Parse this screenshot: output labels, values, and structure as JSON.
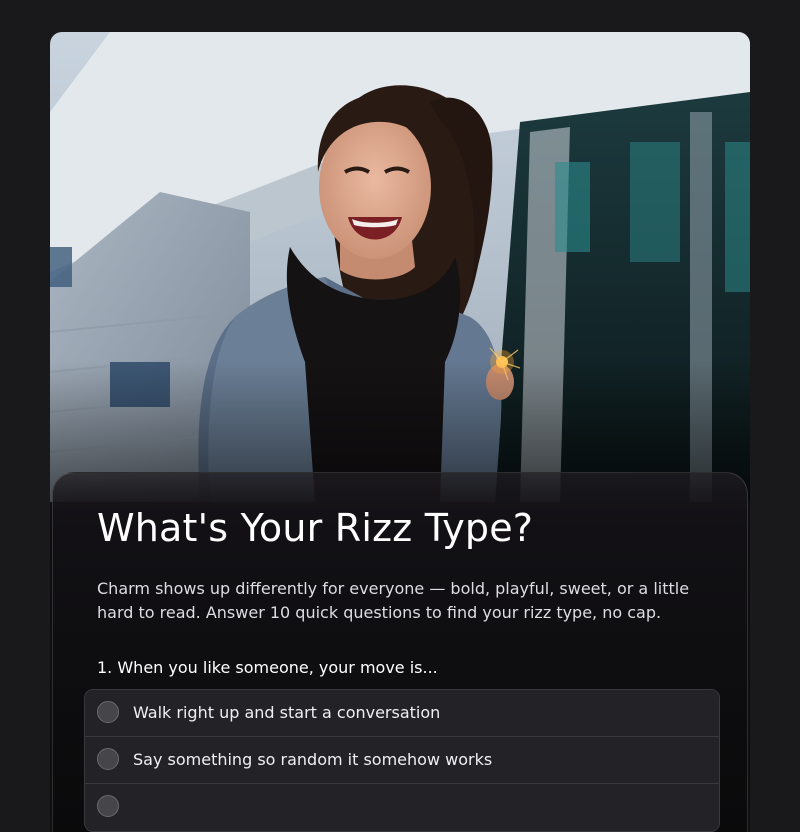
{
  "quiz": {
    "title": "What's Your Rizz Type?",
    "intro": "Charm shows up differently for everyone — bold, playful, sweet, or a little hard to read. Answer 10 quick questions to find your rizz type, no cap.",
    "questions": [
      {
        "label": "1. When you like someone, your move is...",
        "options": [
          {
            "label": "Walk right up and start a conversation",
            "selected": false
          },
          {
            "label": "Say something so random it somehow works",
            "selected": false
          },
          {
            "label": "",
            "selected": false
          }
        ]
      }
    ]
  },
  "hero": {
    "image_subject": "smiling woman in a denim jacket and black scarf holding a sparkler in front of a glass building"
  },
  "colors": {
    "page_background": "#19181b",
    "panel_background": "#0f0e11",
    "option_background": "#232226",
    "option_border": "#3a393e",
    "text_primary": "#ffffff"
  }
}
